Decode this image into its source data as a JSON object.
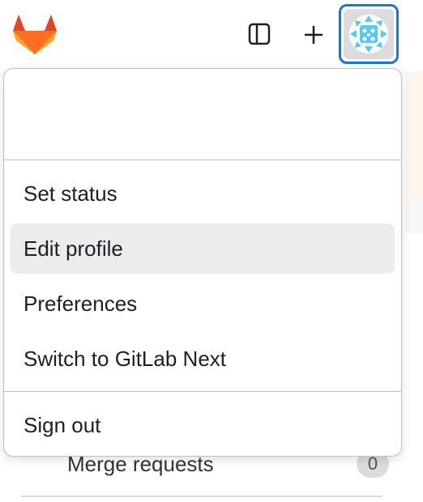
{
  "topbar": {
    "logo_icon": "gitlab-logo-icon",
    "sidebar_toggle_icon": "sidebar-toggle-icon",
    "new_icon": "plus-icon",
    "avatar_icon": "user-avatar-icon"
  },
  "user_menu": {
    "items": [
      {
        "label": "Set status"
      },
      {
        "label": "Edit profile"
      },
      {
        "label": "Preferences"
      },
      {
        "label": "Switch to GitLab Next"
      },
      {
        "label": "Sign out"
      }
    ],
    "active_item": "Edit profile"
  },
  "background": {
    "row_label": "Merge requests",
    "row_count": "0"
  },
  "colors": {
    "accent": "#1f75cb",
    "logo_orange": "#fc6d26",
    "logo_red": "#e24329",
    "logo_light": "#fca326",
    "hover_bg": "#ececef"
  }
}
